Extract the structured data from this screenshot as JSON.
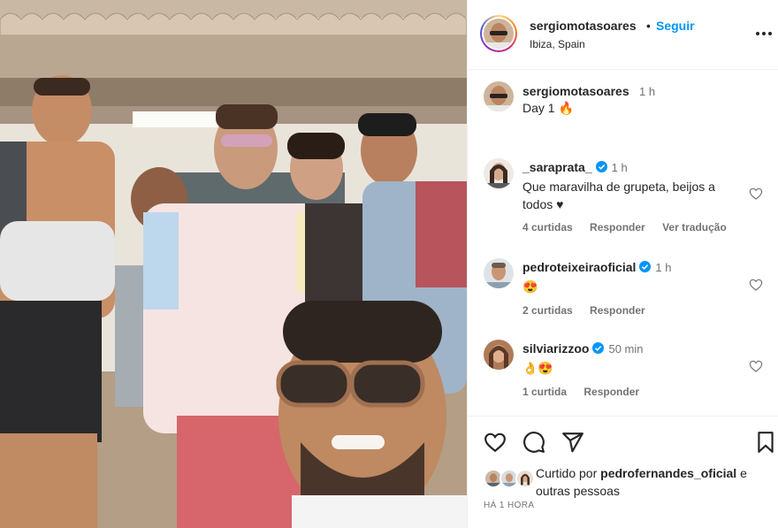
{
  "post": {
    "author": "sergiomotasoares",
    "follow_label": "Seguir",
    "location": "Ibiza, Spain",
    "more_icon": "more-horizontal-icon"
  },
  "caption": {
    "author": "sergiomotasoares",
    "time": "1 h",
    "text": "Day 1 🔥"
  },
  "comments": [
    {
      "user": "_saraprata_",
      "verified": true,
      "time": "1 h",
      "text": "Que maravilha de grupeta, beijos a todos ♥",
      "likes": "4 curtidas",
      "reply": "Responder",
      "translate": "Ver tradução"
    },
    {
      "user": "pedroteixeiraoficial",
      "verified": true,
      "time": "1 h",
      "text": "😍",
      "likes": "2 curtidas",
      "reply": "Responder"
    },
    {
      "user": "silviarizzoo",
      "verified": true,
      "time": "50 min",
      "text": "👌😍",
      "likes": "1 curtida",
      "reply": "Responder"
    }
  ],
  "footer": {
    "liked_prefix": "Curtido por",
    "liked_user": "pedrofernandes_oficial",
    "liked_suffix": "e outras pessoas",
    "timestamp": "HÁ 1 HORA"
  },
  "colors": {
    "link_blue": "#0095f6",
    "verified_blue": "#0095f6",
    "muted": "#737373",
    "text": "#262626",
    "divider": "#efefef"
  }
}
